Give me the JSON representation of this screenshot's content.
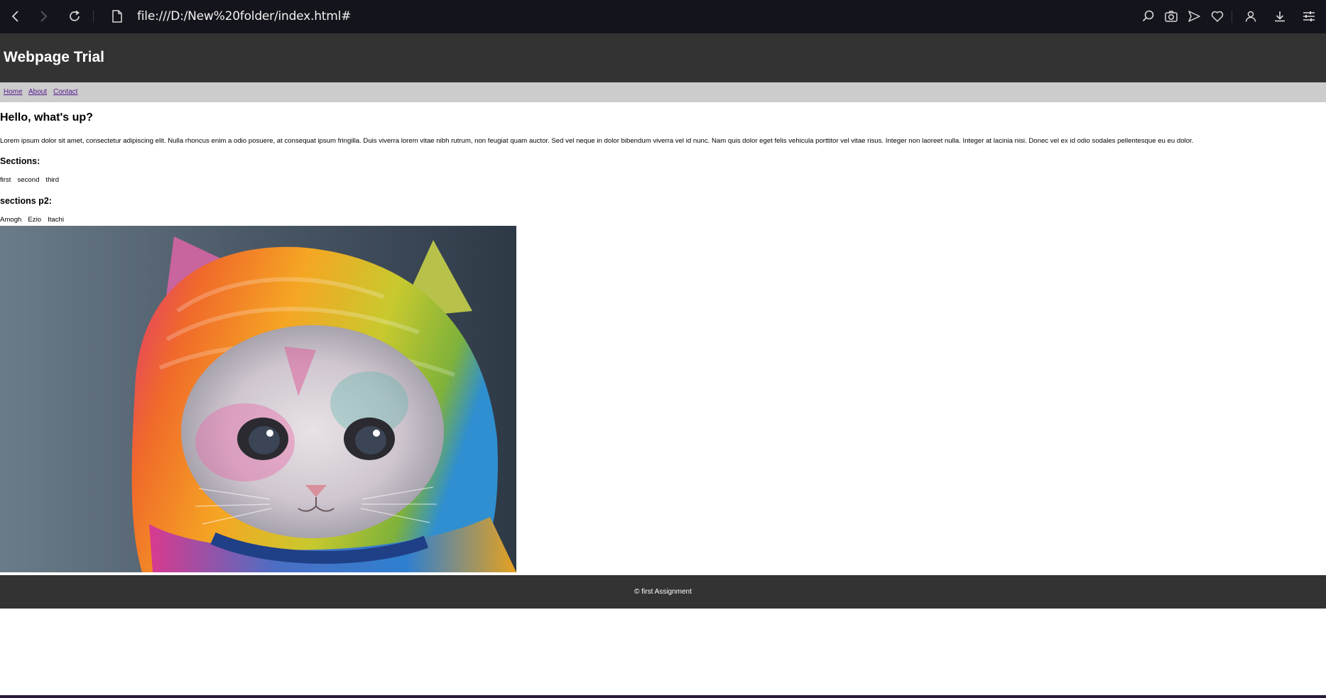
{
  "browser": {
    "url": "file:///D:/New%20folder/index.html#",
    "icons": [
      "back-icon",
      "forward-icon",
      "reload-icon",
      "page-icon",
      "search-icon",
      "camera-icon",
      "send-icon",
      "heart-icon",
      "profile-icon",
      "download-icon",
      "settings-icon"
    ]
  },
  "header": {
    "title": "Webpage Trial"
  },
  "nav": {
    "items": [
      "Home",
      "About",
      "Contact"
    ],
    "link_color": "#551a8b"
  },
  "main": {
    "heading": "Hello, what's up?",
    "paragraph": "Lorem ipsum dolor sit amet, consectetur adipiscing elit. Nulla rhoncus enim a odio posuere, at consequat ipsum fringilla. Duis viverra lorem vitae nibh rutrum, non feugiat quam auctor. Sed vel neque in dolor bibendum viverra vel id nunc. Nam quis dolor eget felis vehicula porttitor vel vitae risus. Integer non laoreet nulla. Integer at lacinia nisi. Donec vel ex id odio sodales pellentesque eu eu dolor.",
    "sections_title": "Sections:",
    "sections": [
      "first",
      "second",
      "third"
    ],
    "sections2_title": "sections p2:",
    "sections2": [
      "Amogh",
      "Ezio",
      "Itachi"
    ],
    "image_subject": "kitten wearing rainbow knitted hood"
  },
  "footer": {
    "text": "© first Assignment"
  },
  "colors": {
    "chrome": "#14141c",
    "header": "#333333",
    "nav": "#cccccc",
    "footer": "#333333"
  }
}
